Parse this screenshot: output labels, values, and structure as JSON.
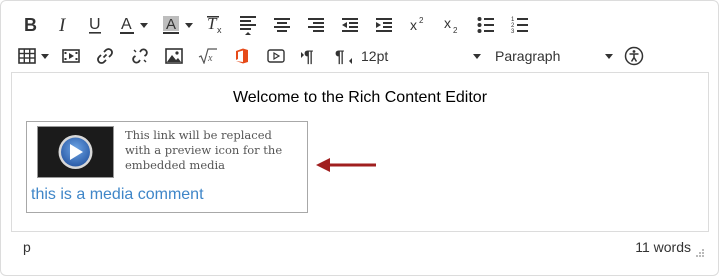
{
  "toolbar": {
    "font_size_value": "12pt",
    "block_format_value": "Paragraph"
  },
  "content": {
    "title": "Welcome to the Rich Content Editor",
    "media_note": "This link will be replaced with a preview icon for the embedded media",
    "media_link": "this is a media comment"
  },
  "status": {
    "path": "p",
    "word_count": "11 words"
  },
  "colors": {
    "arrow": "#a01f1f",
    "link": "#3f86c8",
    "play_button": "#3a6fc1"
  },
  "icons": [
    "bold-icon",
    "italic-icon",
    "underline-icon",
    "font-color-icon",
    "background-color-icon",
    "clear-formatting-icon",
    "align-left-icon",
    "align-center-icon",
    "align-right-icon",
    "outdent-icon",
    "indent-icon",
    "superscript-icon",
    "subscript-icon",
    "bullet-list-icon",
    "numbered-list-icon",
    "table-icon",
    "media-icon",
    "link-icon",
    "unlink-icon",
    "image-icon",
    "math-icon",
    "office-icon",
    "video-icon",
    "ltr-icon",
    "rtl-icon",
    "accessibility-icon"
  ]
}
